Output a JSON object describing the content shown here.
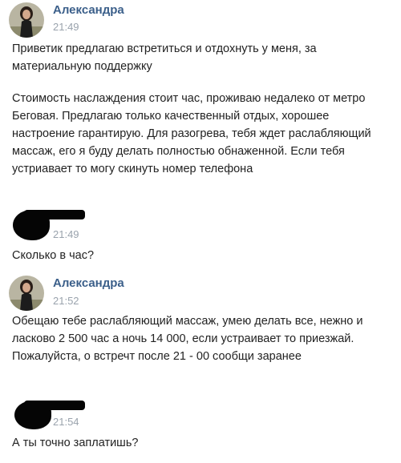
{
  "messages": [
    {
      "author": "Александра",
      "time": "21:49",
      "paragraphs": [
        "Приветик предлагаю встретиться и отдохнуть у меня, за материальную поддержку",
        "Стоимость наслаждения стоит час, проживаю недалеко от метро Беговая. Предлагаю только качественный отдых, хорошее настроение гарантирую. Для разогрева, тебя ждет раслабляющий массаж, его я буду делать полностью обнаженной. Если тебя устриавает то могу скинуть номер телефона"
      ]
    },
    {
      "author": "",
      "time": "21:49",
      "paragraphs": [
        "Сколько в час?"
      ]
    },
    {
      "author": "Александра",
      "time": "21:52",
      "paragraphs": [
        "Обещаю тебе раслабляющий массаж, умею делать все, нежно и ласково 2 500 час а ночь 14 000, если устраивает то приезжай. Пожалуйста, о встречт после 21 - 00 сообщи заранее"
      ]
    },
    {
      "author": "",
      "time": "21:54",
      "paragraphs": [
        "А ты точно заплатишь?"
      ]
    }
  ]
}
